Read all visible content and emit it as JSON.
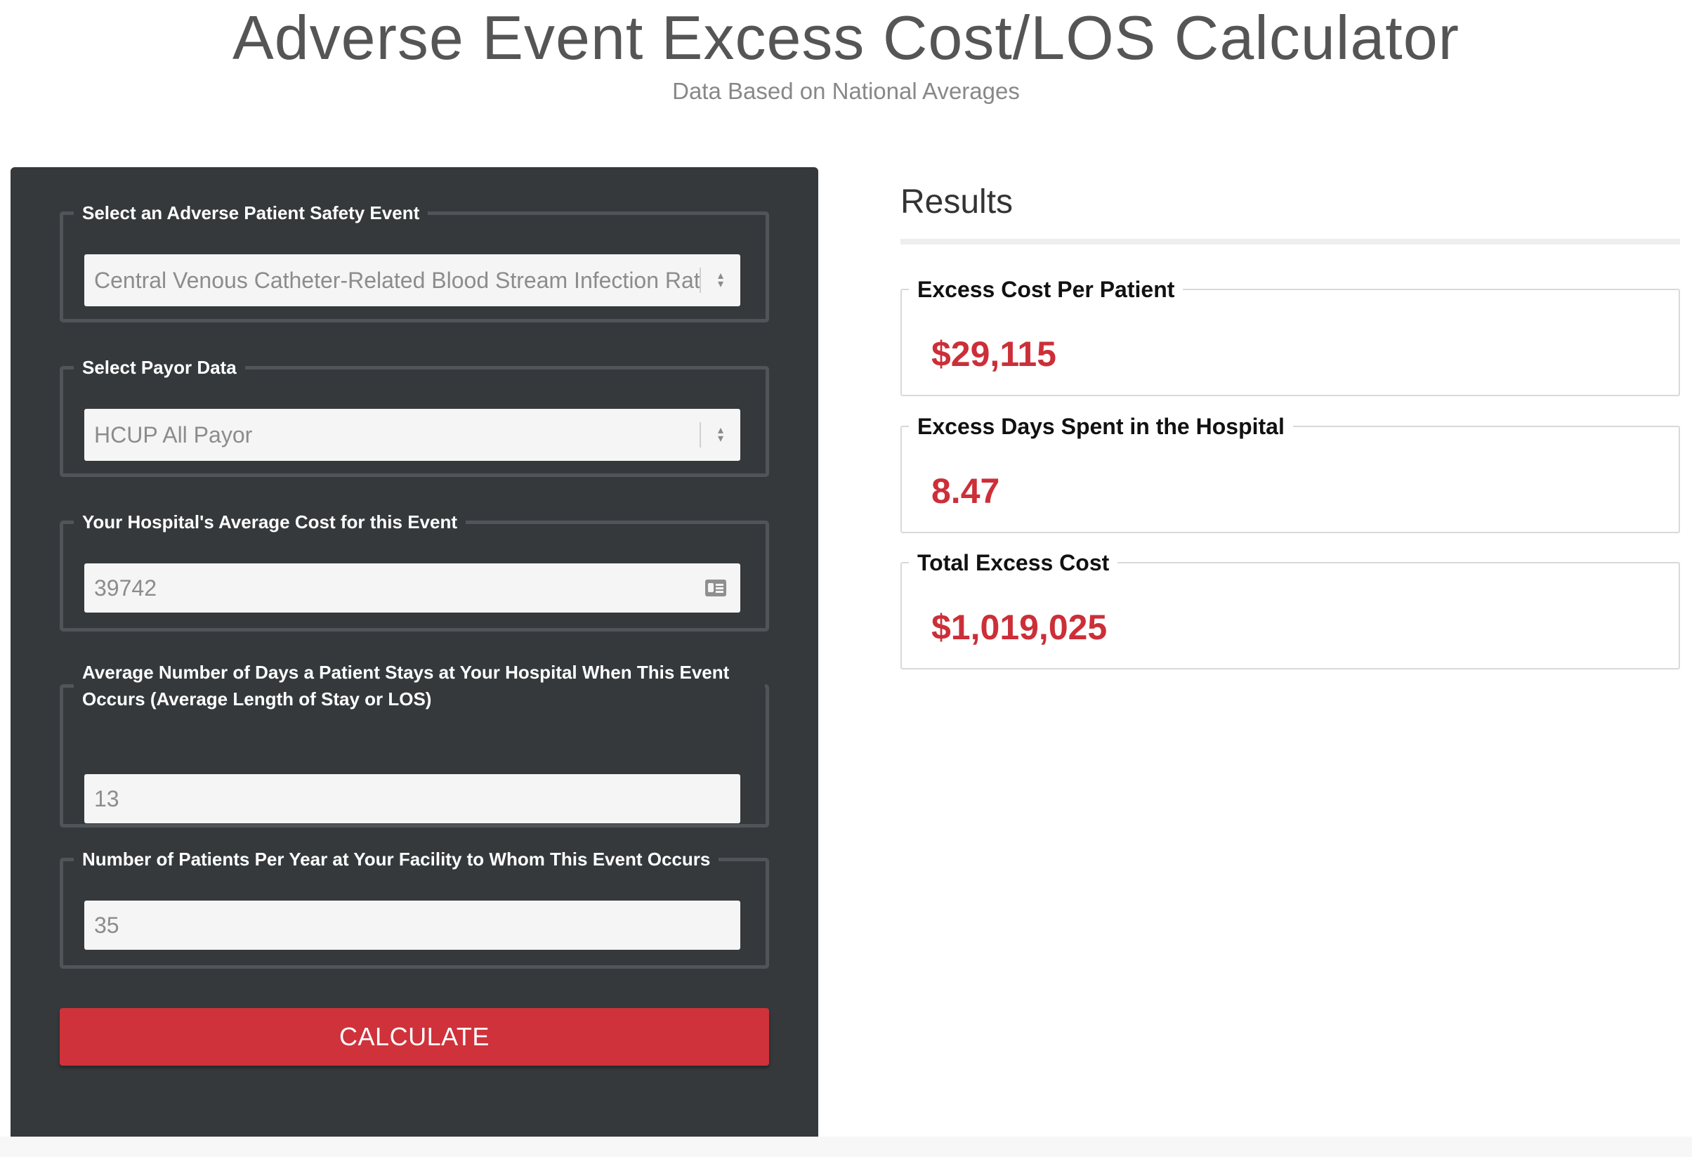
{
  "header": {
    "title": "Adverse Event Excess Cost/LOS Calculator",
    "subtitle": "Data Based on National Averages"
  },
  "form": {
    "event": {
      "legend": "Select an Adverse Patient Safety Event",
      "selected": "Central Venous Catheter-Related Blood Stream Infection Rate"
    },
    "payor": {
      "legend": "Select Payor Data",
      "selected": "HCUP All Payor"
    },
    "avg_cost": {
      "legend": "Your Hospital's Average Cost for this Event",
      "value": "39742"
    },
    "avg_los": {
      "legend": "Average Number of Days a Patient Stays at Your Hospital When This Event Occurs (Average Length of Stay or LOS)",
      "value": "13"
    },
    "patients_per_year": {
      "legend": "Number of Patients Per Year at Your Facility to Whom This Event Occurs",
      "value": "35"
    },
    "calculate_label": "CALCULATE"
  },
  "results": {
    "heading": "Results",
    "excess_cost_per_patient": {
      "label": "Excess Cost Per Patient",
      "value": "$29,115"
    },
    "excess_days": {
      "label": "Excess Days Spent in the Hospital",
      "value": "8.47"
    },
    "total_excess_cost": {
      "label": "Total Excess Cost",
      "value": "$1,019,025"
    }
  },
  "icons": {
    "select_caret": "select-caret-icon",
    "contact_card": "contact-card-icon"
  },
  "colors": {
    "panel_bg": "#35393c",
    "accent_red": "#cf323a",
    "result_red": "#cc2f38"
  }
}
